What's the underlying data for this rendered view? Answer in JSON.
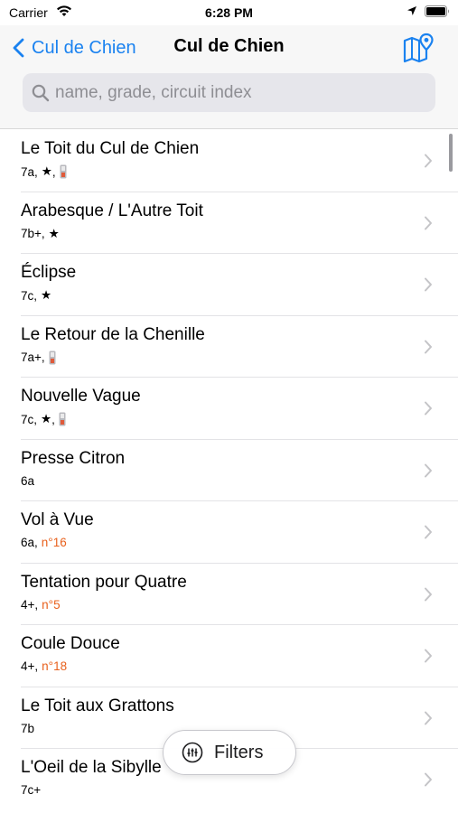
{
  "status_bar": {
    "carrier": "Carrier",
    "time": "6:28 PM"
  },
  "nav": {
    "back_label": "Cul de Chien",
    "title": "Cul de Chien"
  },
  "search": {
    "placeholder": "name, grade, circuit index"
  },
  "list": [
    {
      "title": "Le Toit du Cul de Chien",
      "grade": "7a",
      "star": true,
      "pad": true,
      "circuit": ""
    },
    {
      "title": "Arabesque / L'Autre Toit",
      "grade": "7b+",
      "star": true,
      "pad": false,
      "circuit": ""
    },
    {
      "title": "Éclipse",
      "grade": "7c",
      "star": true,
      "pad": false,
      "circuit": ""
    },
    {
      "title": "Le Retour de la Chenille",
      "grade": "7a+",
      "star": false,
      "pad": true,
      "circuit": ""
    },
    {
      "title": "Nouvelle Vague",
      "grade": "7c",
      "star": true,
      "pad": true,
      "circuit": ""
    },
    {
      "title": "Presse Citron",
      "grade": "6a",
      "star": false,
      "pad": false,
      "circuit": ""
    },
    {
      "title": "Vol à Vue",
      "grade": "6a",
      "star": false,
      "pad": false,
      "circuit": "n°16"
    },
    {
      "title": "Tentation pour Quatre",
      "grade": "4+",
      "star": false,
      "pad": false,
      "circuit": "n°5"
    },
    {
      "title": "Coule Douce",
      "grade": "4+",
      "star": false,
      "pad": false,
      "circuit": "n°18"
    },
    {
      "title": "Le Toit aux Grattons",
      "grade": "7b",
      "star": false,
      "pad": false,
      "circuit": ""
    },
    {
      "title": "L'Oeil de la Sibylle",
      "grade": "7c+",
      "star": false,
      "pad": false,
      "circuit": ""
    }
  ],
  "filters_button": {
    "label": "Filters"
  },
  "colors": {
    "accent": "#1a82f0",
    "circuit": "#e8601c",
    "search_bg": "#e6e6eb"
  },
  "icons": [
    "wifi-icon",
    "location-arrow-icon",
    "battery-icon",
    "chevron-left-icon",
    "map-icon",
    "search-icon",
    "star-icon",
    "crash-pad-icon",
    "chevron-right-icon",
    "filters-icon"
  ]
}
